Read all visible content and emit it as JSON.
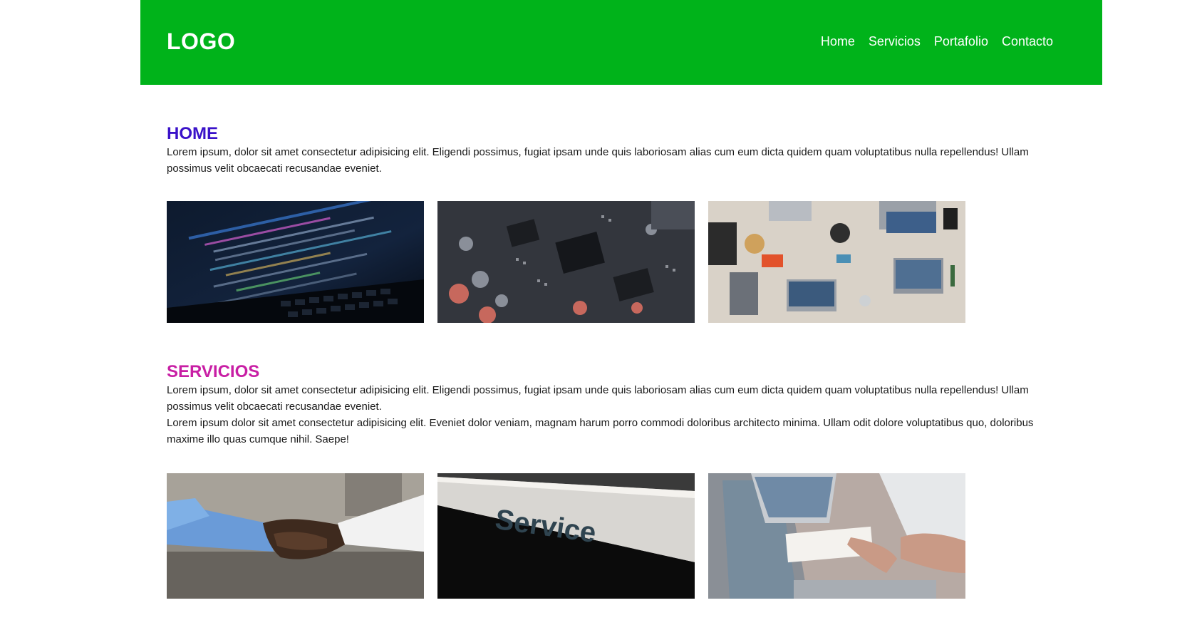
{
  "header": {
    "logo": "LOGO",
    "nav": [
      "Home",
      "Servicios",
      "Portafolio",
      "Contacto"
    ],
    "background": "#00b31a"
  },
  "home": {
    "title": "HOME",
    "title_color": "#3a12c9",
    "paragraph": "Lorem ipsum, dolor sit amet consectetur adipisicing elit. Eligendi possimus, fugiat ipsam unde quis laboriosam alias cum eum dicta quidem quam voluptatibus nulla repellendus! Ullam possimus velit obcaecati recusandae eveniet.",
    "images": [
      "code-laptop-photo",
      "circuit-board-photo",
      "team-desk-laptops-photo"
    ]
  },
  "servicios": {
    "title": "SERVICIOS",
    "title_color": "#c81ea4",
    "paragraph1": "Lorem ipsum, dolor sit amet consectetur adipisicing elit. Eligendi possimus, fugiat ipsam unde quis laboriosam alias cum eum dicta quidem quam voluptatibus nulla repellendus! Ullam possimus velit obcaecati recusandae eveniet.",
    "paragraph2": "Lorem ipsum dolor sit amet consectetur adipisicing elit. Eveniet dolor veniam, magnam harum porro commodi doloribus architecto minima. Ullam odit dolore voluptatibus quo, doloribus maxime illo quas cumque nihil. Saepe!",
    "images": [
      "handshake-photo",
      "service-sign-photo",
      "meeting-laptop-photo"
    ],
    "sign_text": "Service"
  }
}
